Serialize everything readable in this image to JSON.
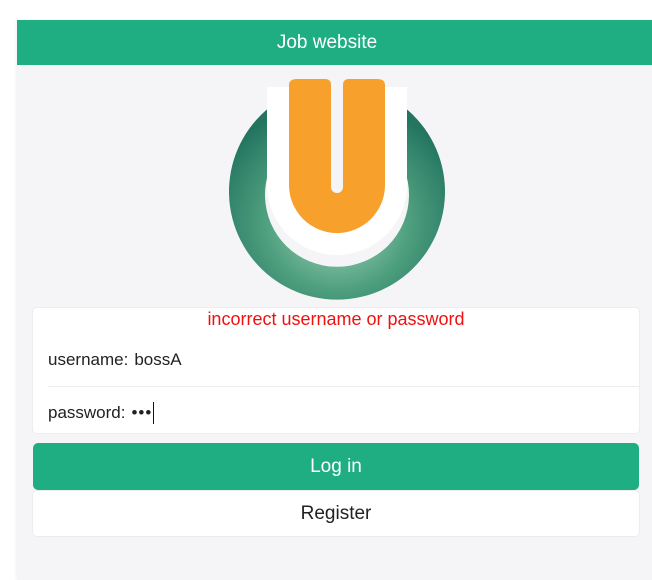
{
  "header": {
    "title": "Job website"
  },
  "logo": {
    "name": "u-logo-icon",
    "colors": {
      "ring": "#2e8a6e",
      "letter": "#f7a02c"
    }
  },
  "login_form": {
    "error_message": "incorrect username or password",
    "username_label": "username:",
    "username_value": "bossA",
    "password_label": "password:",
    "password_masked": "•••"
  },
  "buttons": {
    "login": "Log in",
    "register": "Register"
  },
  "colors": {
    "primary": "#1fae82",
    "error": "#ee1111",
    "background": "#f5f5f8"
  }
}
